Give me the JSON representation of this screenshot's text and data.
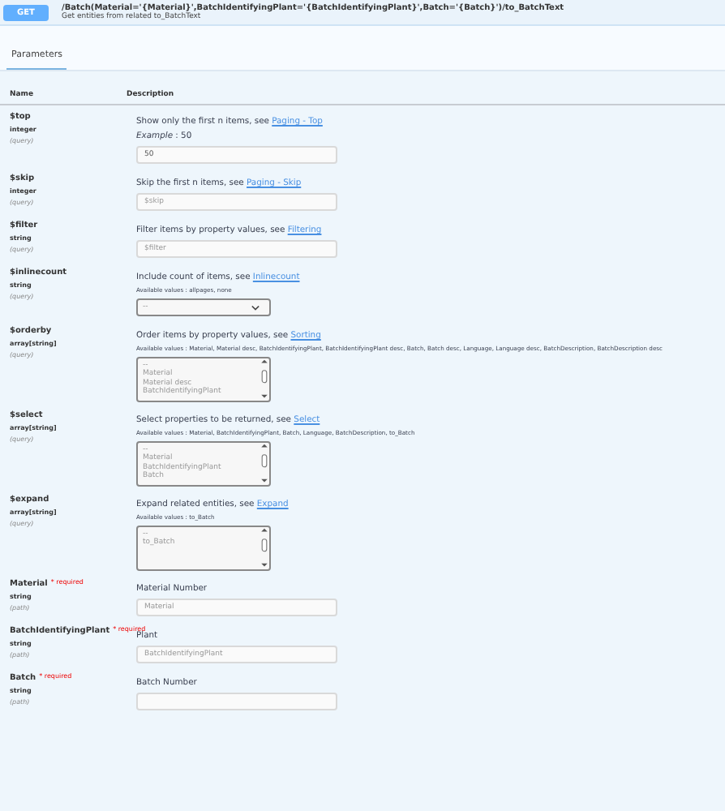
{
  "operation": {
    "method": "GET",
    "path": "/Batch(Material='{Material}',BatchIdentifyingPlant='{BatchIdentifyingPlant}',Batch='{Batch}')/to_BatchText",
    "summary": "Get entities from related to_BatchText"
  },
  "tabs": [
    {
      "label": "Parameters",
      "selected": true
    }
  ],
  "columns": [
    "Name",
    "Description"
  ],
  "parameters": [
    {
      "name": "$top",
      "type": "integer",
      "location": "(query)",
      "description": "Show only the first n items, see ",
      "link": "Paging - Top",
      "example": "*Example* : 50",
      "kind": "input",
      "value": "50"
    },
    {
      "name": "$skip",
      "type": "integer",
      "location": "(query)",
      "description": "Skip the first n items, see ",
      "link": "Paging - Skip",
      "kind": "input",
      "placeholder": "$skip"
    },
    {
      "name": "$filter",
      "type": "string",
      "location": "(query)",
      "description": "Filter items by property values, see ",
      "link": "Filtering",
      "kind": "input",
      "placeholder": "$filter"
    },
    {
      "name": "$inlinecount",
      "type": "string",
      "location": "(query)",
      "description": "Include count of items, see ",
      "link": "Inlinecount",
      "available": "Available values : allpages, none",
      "kind": "select",
      "value": "--"
    },
    {
      "name": "$orderby",
      "type": "array[string]",
      "location": "(query)",
      "description": "Order items by property values, see ",
      "link": "Sorting",
      "available": "Available values : Material, Material desc, BatchIdentifyingPlant, BatchIdentifyingPlant desc, Batch, Batch desc, Language, Language desc, BatchDescription, BatchDescription desc",
      "kind": "multiselect",
      "options": [
        "--",
        "Material",
        "Material desc",
        "BatchIdentifyingPlant"
      ]
    },
    {
      "name": "$select",
      "type": "array[string]",
      "location": "(query)",
      "description": "Select properties to be returned, see ",
      "link": "Select",
      "available": "Available values : Material, BatchIdentifyingPlant, Batch, Language, BatchDescription, to_Batch",
      "kind": "multiselect",
      "options": [
        "--",
        "Material",
        "BatchIdentifyingPlant",
        "Batch"
      ]
    },
    {
      "name": "$expand",
      "type": "array[string]",
      "location": "(query)",
      "description": "Expand related entities, see ",
      "link": "Expand",
      "available": "Available values : to_Batch",
      "kind": "multiselect",
      "options": [
        "--",
        "to_Batch"
      ]
    },
    {
      "name": "Material",
      "type": "string",
      "location": "(path)",
      "required_label": "* required",
      "description": "Material Number",
      "kind": "input",
      "placeholder": "Material"
    },
    {
      "name": "BatchIdentifyingPlant",
      "type": "string",
      "location": "(path)",
      "required_label": "* required",
      "description": "Plant",
      "kind": "input",
      "placeholder": "BatchIdentifyingPlant"
    },
    {
      "name": "Batch",
      "type": "string",
      "location": "(path)",
      "required_label": "* required",
      "description": "Batch Number",
      "kind": "input"
    }
  ]
}
